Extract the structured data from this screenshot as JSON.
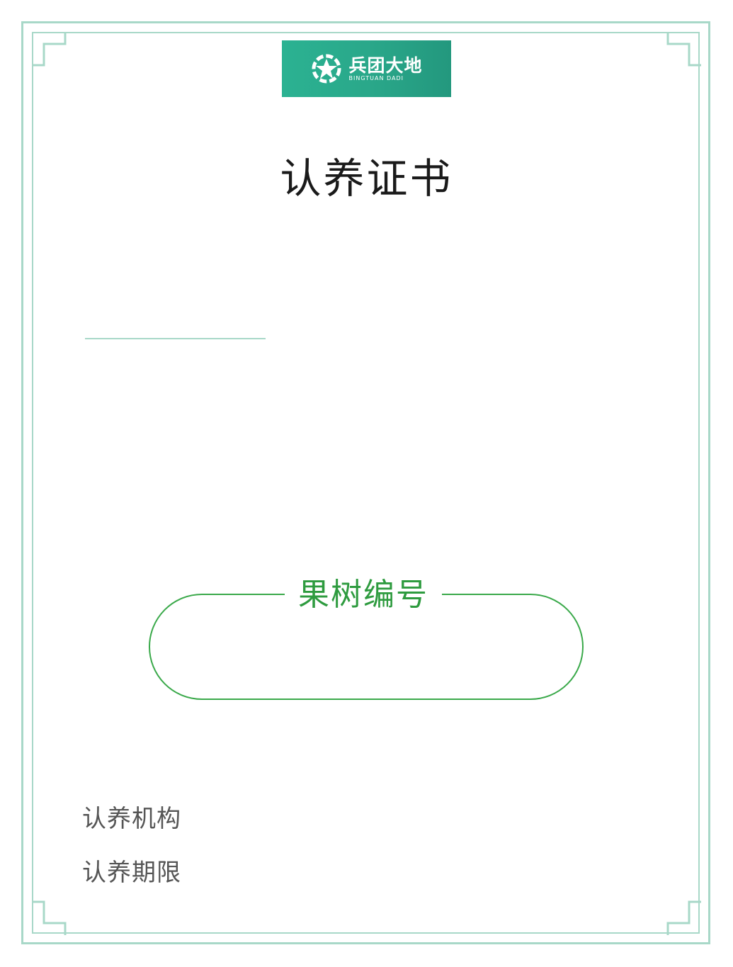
{
  "logo": {
    "cn": "兵团大地",
    "en": "BINGTUAN DADI",
    "icon": "star-logo-icon",
    "color": "#2aa88a"
  },
  "certificate": {
    "title": "认养证书",
    "tree_number_label": "果树编号"
  },
  "info": {
    "organization_label": "认养机构",
    "period_label": "认养期限"
  },
  "colors": {
    "frame": "#a8d8c8",
    "accent_green": "#2e9b3f",
    "title_text": "#1a1a1a",
    "label_text": "#555555"
  }
}
